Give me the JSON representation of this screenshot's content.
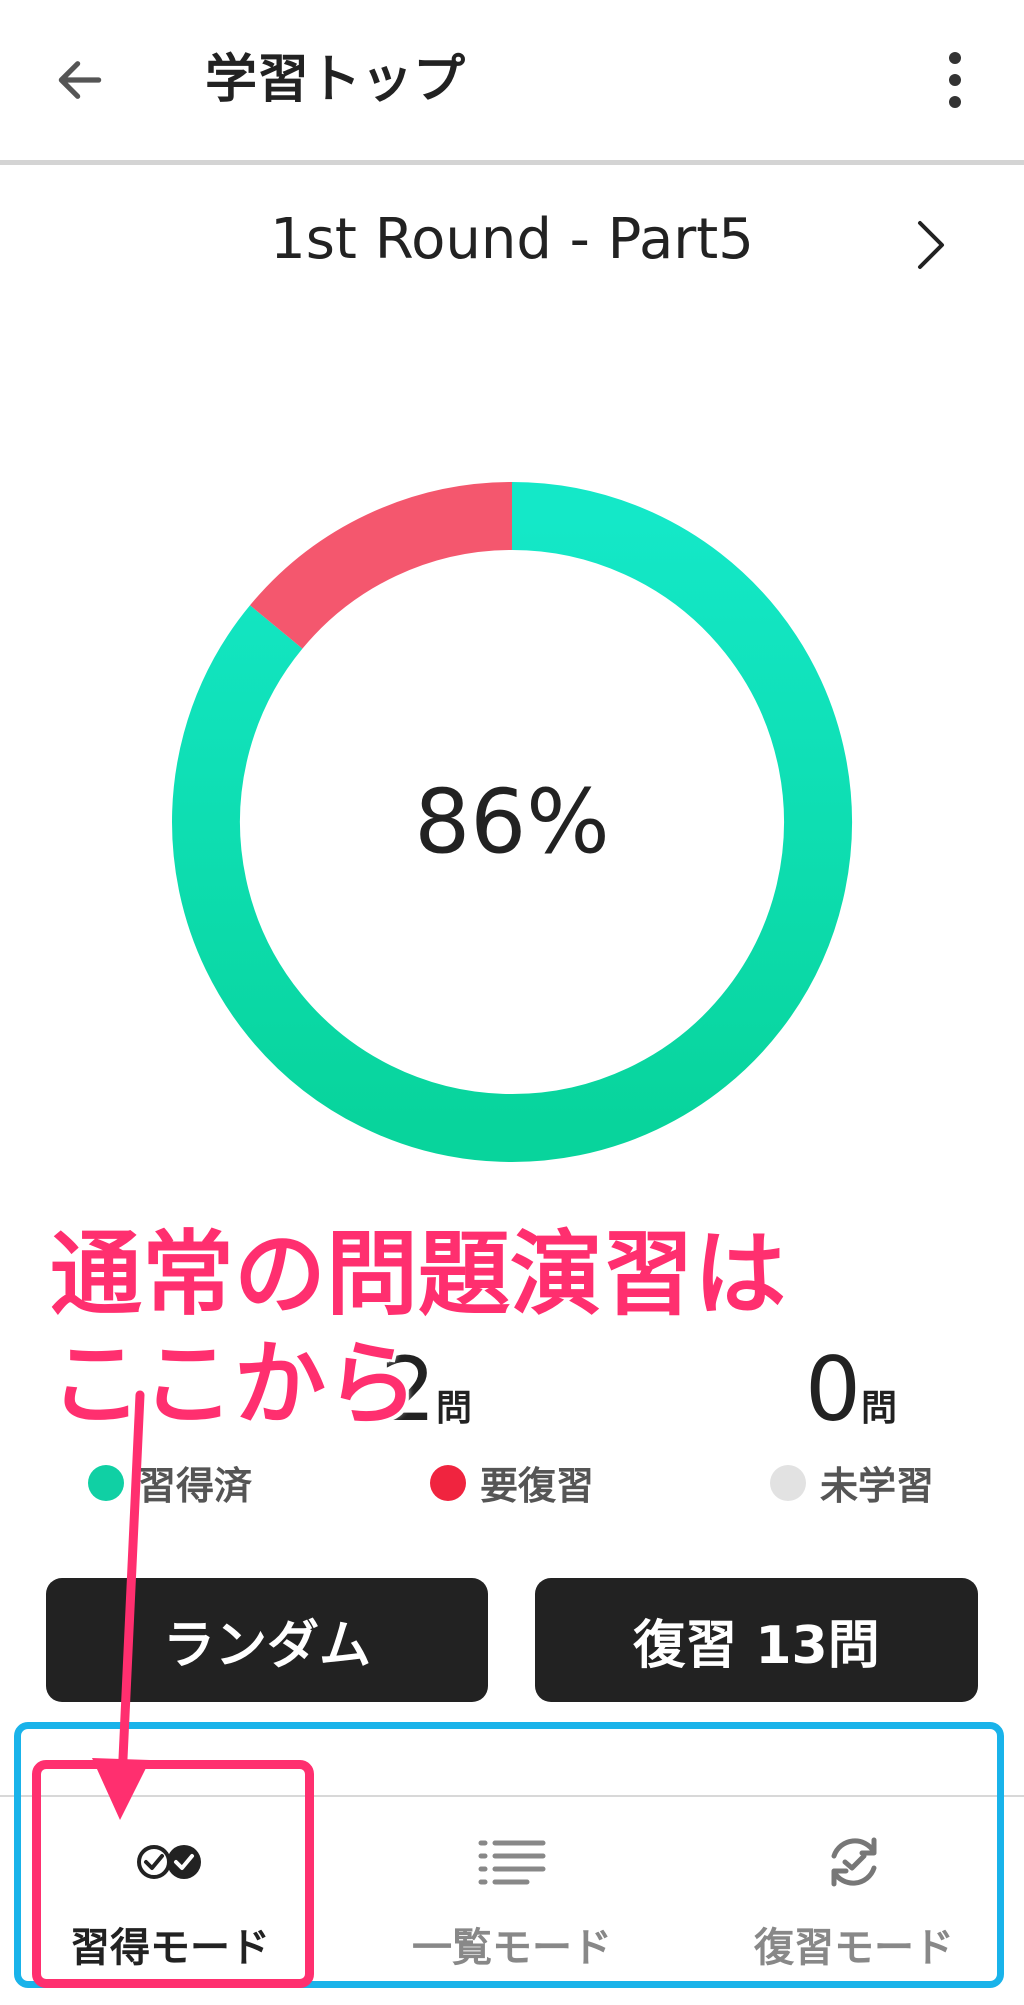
{
  "header": {
    "title": "学習トップ",
    "back_icon": "arrow-left-icon",
    "more_icon": "more-vertical-icon"
  },
  "round": {
    "title": "1st Round - Part5",
    "next_icon": "chevron-right-icon"
  },
  "progress": {
    "percent_label": "86%",
    "mastered_fraction": 0.86,
    "review_fraction": 0.14,
    "colors": {
      "mastered": "#10dbb0",
      "review": "#f4576e",
      "unlearned": "#e0e0e0"
    }
  },
  "stats": [
    {
      "count": "",
      "unit": "",
      "label": "習得済",
      "color": "#10d0a4"
    },
    {
      "count": "2",
      "unit": "問",
      "label": "要復習",
      "color": "#f0243f"
    },
    {
      "count": "0",
      "unit": "問",
      "label": "未学習",
      "color": "#e2e2e2"
    }
  ],
  "buttons": {
    "random": "ランダム",
    "review": "復習 13問"
  },
  "bottom_nav": [
    {
      "label": "習得モード",
      "icon": "double-check-icon",
      "active": true
    },
    {
      "label": "一覧モード",
      "icon": "list-icon",
      "active": false
    },
    {
      "label": "復習モード",
      "icon": "refresh-check-icon",
      "active": false
    }
  ],
  "annotation": {
    "text": "通常の問題演習は\nここから",
    "colors": {
      "callout": "#ff2f6f",
      "frame": "#19b3ea"
    }
  }
}
